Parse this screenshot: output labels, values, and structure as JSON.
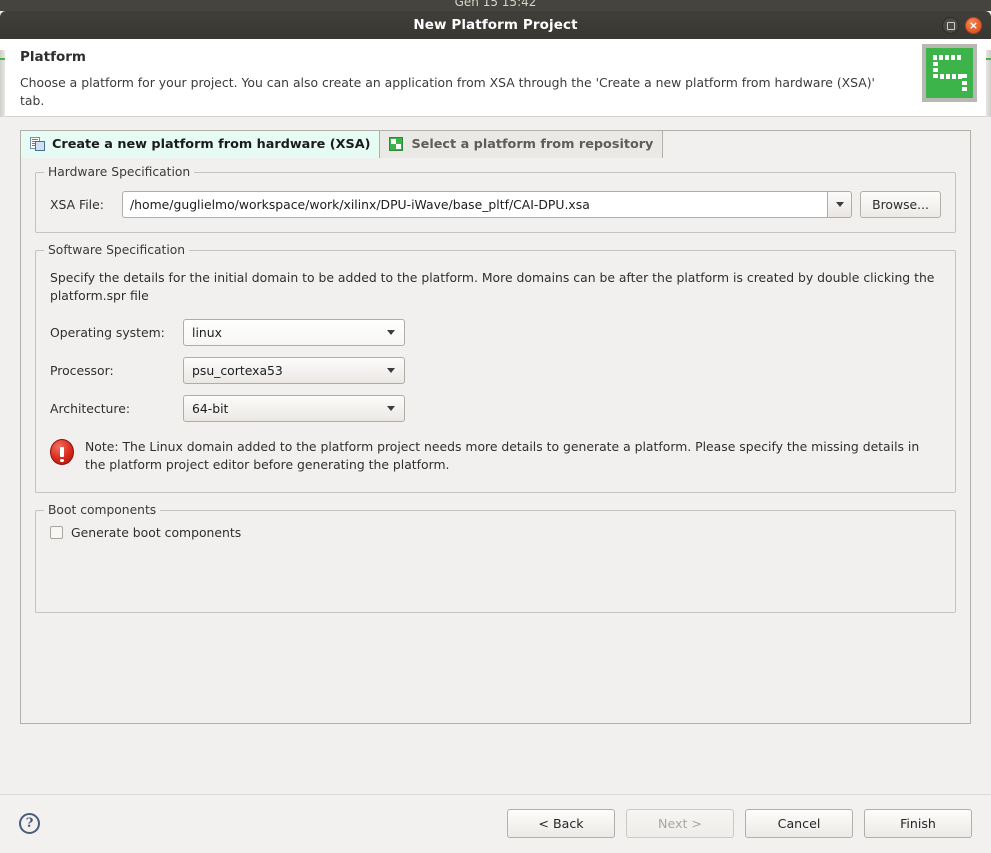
{
  "desktop": {
    "clock": "Gen 15 15:42"
  },
  "window": {
    "title": "New Platform Project",
    "maximize_label": "maximize",
    "close_label": "×"
  },
  "header": {
    "title": "Platform",
    "description": "Choose a platform for your project. You can also create an application from XSA through the 'Create a new platform from hardware (XSA)' tab.",
    "icon": "platform-chip-icon"
  },
  "tabs": [
    {
      "label": "Create a new platform from hardware (XSA)",
      "icon": "hardware-xsa-icon",
      "active": true
    },
    {
      "label": "Select a platform from repository",
      "icon": "repository-icon",
      "active": false
    }
  ],
  "hardware": {
    "group_title": "Hardware Specification",
    "xsa_label": "XSA File:",
    "xsa_value": "/home/guglielmo/workspace/work/xilinx/DPU-iWave/base_pltf/CAI-DPU.xsa",
    "xsa_placeholder": "",
    "dropdown_icon": "chevron-down-icon",
    "browse_label": "Browse..."
  },
  "software": {
    "group_title": "Software Specification",
    "description": "Specify the details for the initial domain to be added to the platform. More domains can be after the platform is created by double clicking the platform.spr file",
    "fields": [
      {
        "label": "Operating system:",
        "value": "linux"
      },
      {
        "label": "Processor:",
        "value": "psu_cortexa53"
      },
      {
        "label": "Architecture:",
        "value": "64-bit"
      }
    ],
    "note": {
      "icon": "error-icon",
      "text": "Note: The Linux domain added to the platform project needs more details to generate a platform. Please specify the missing details in the platform project editor before generating the platform."
    }
  },
  "boot": {
    "group_title": "Boot components",
    "checkbox_label": "Generate boot components",
    "checked": false
  },
  "footer": {
    "help_icon": "help-icon",
    "help_glyph": "?",
    "buttons": [
      {
        "label": "< Back",
        "disabled": false,
        "name": "back-button"
      },
      {
        "label": "Next >",
        "disabled": true,
        "name": "next-button"
      },
      {
        "label": "Cancel",
        "disabled": false,
        "name": "cancel-button"
      },
      {
        "label": "Finish",
        "disabled": false,
        "name": "finish-button"
      }
    ]
  },
  "colors": {
    "titlebar": "#3b3a35",
    "close_button": "#e8622c",
    "accent_green": "#3cb44a",
    "active_tab_bg": "#e6fbf4",
    "error_red": "#d8291c",
    "body_bg": "#f2f0ee"
  }
}
